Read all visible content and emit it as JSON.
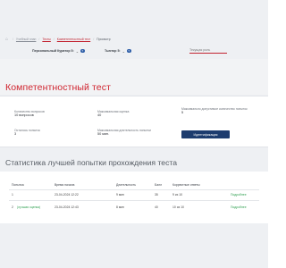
{
  "breadcrumb": {
    "items": [
      "Учебный план",
      "Тесты",
      "Компетентностный тест",
      "Просмотр"
    ]
  },
  "filters": {
    "curator_label": "Персональный Куратор 5:",
    "curator_q": "?",
    "type_label": "Тьютор 5:",
    "type_q": "?",
    "current_role": "Текущая роль"
  },
  "page_title": "Компетентностный тест",
  "info": {
    "q_count_label": "Количество вопросов",
    "q_count_value": "10 вопросов",
    "max_score_label": "Максимальная оценка",
    "max_score_value": "40",
    "max_attempts_label": "Максимально допустимое количество попыток",
    "max_attempts_value": "5",
    "remaining_label": "Осталось попыток",
    "remaining_value": "3",
    "max_duration_label": "Максимальная длительность попытки",
    "max_duration_value": "50 мин.",
    "identify_button": "Идентификация"
  },
  "stats": {
    "title": "Статистика лучшей попытки прохождения теста",
    "columns": [
      "Попытка",
      "Время начала",
      "Длительность",
      "Балл",
      "Корректные ответы"
    ],
    "rows": [
      {
        "attempt": "1",
        "start": "23-04-2024 12:22",
        "duration": "9 мин",
        "score": "35",
        "correct": "9 из 10",
        "more": "Подробнее"
      },
      {
        "attempt": "2",
        "attempt_note": "(лучшая оценка)",
        "start": "23-04-2024 12:43",
        "duration": "8 мин",
        "score": "40",
        "correct": "10 из 10",
        "more": "Подробнее"
      }
    ]
  }
}
